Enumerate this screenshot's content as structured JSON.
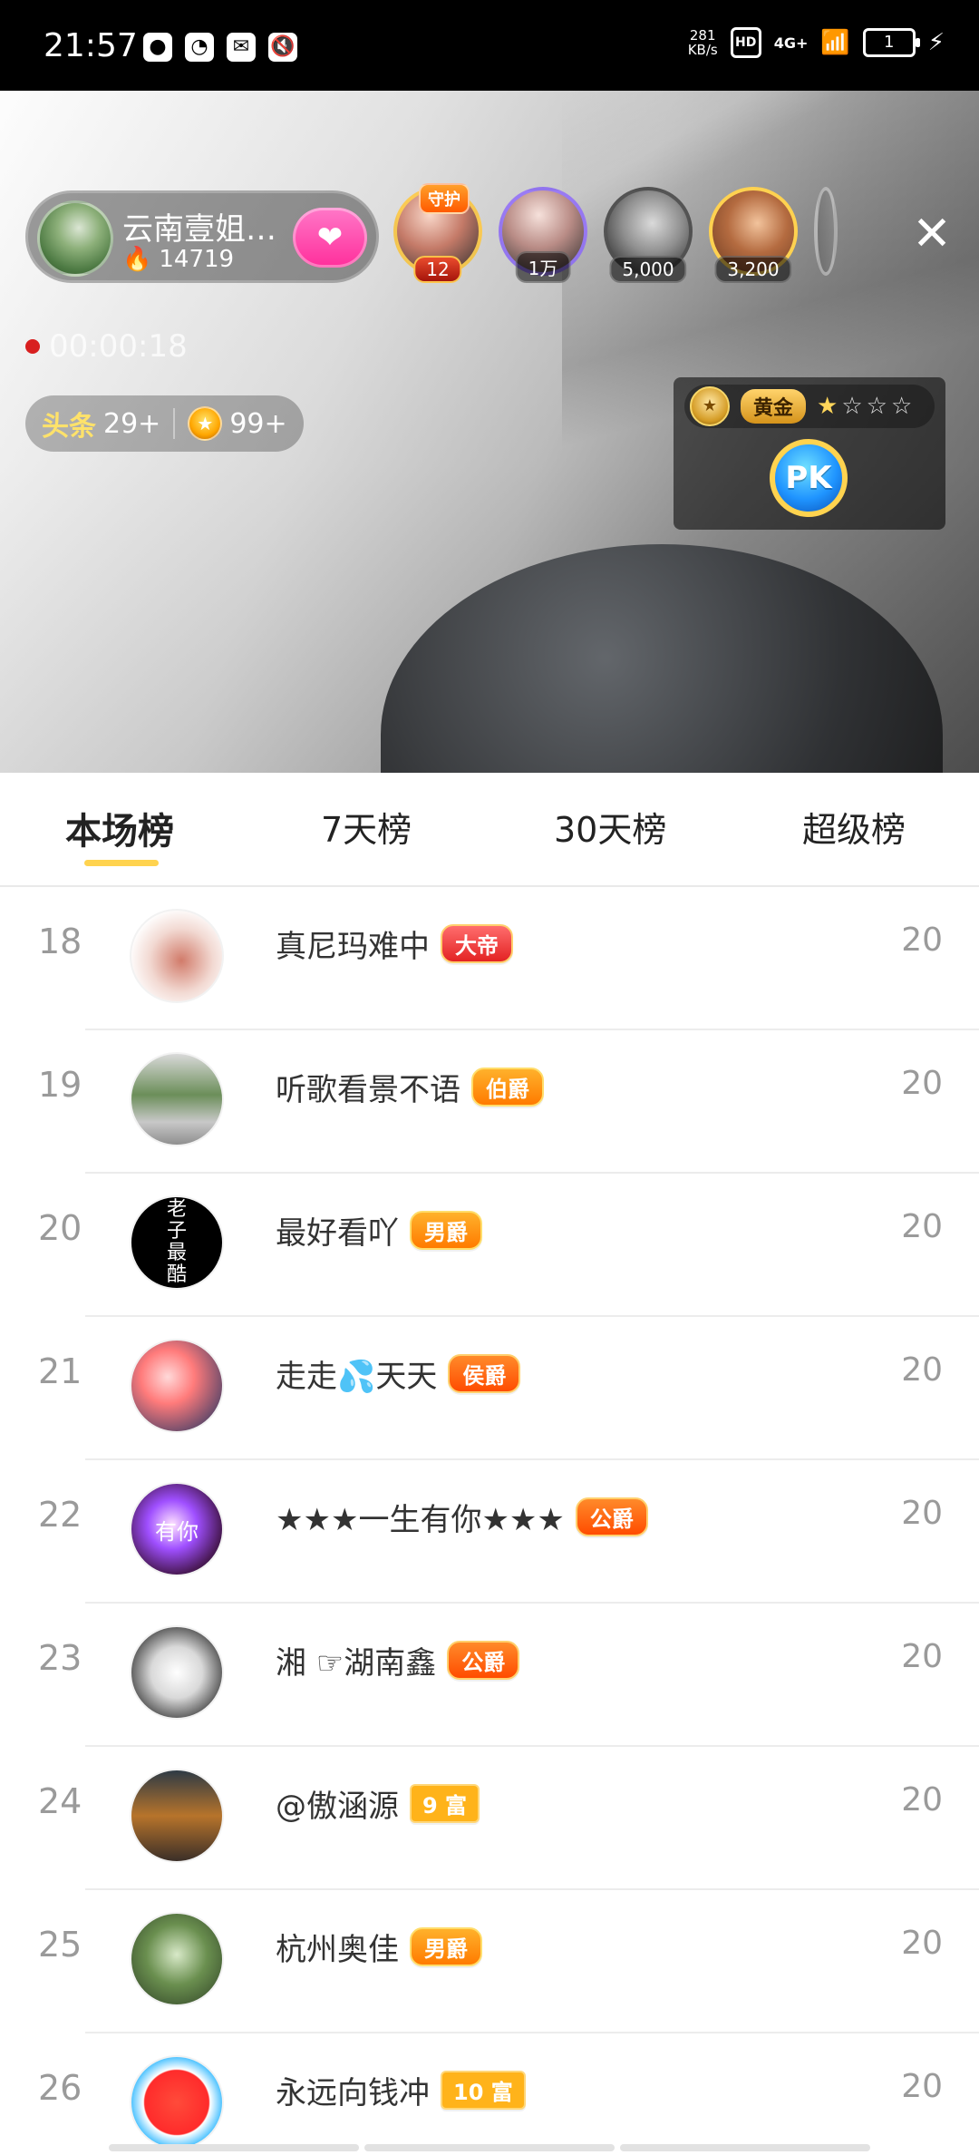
{
  "status_bar": {
    "time": "21:57",
    "net_speed_top": "281",
    "net_speed_bottom": "KB/s",
    "hd": "HD",
    "signal": "4G+",
    "battery": "1"
  },
  "live": {
    "host": {
      "name": "云南壹姐…",
      "heat": "14719"
    },
    "audience": [
      {
        "top_badge": "守护",
        "label": "12"
      },
      {
        "label": "1万"
      },
      {
        "label": "5,000"
      },
      {
        "label": "3,200"
      }
    ],
    "record_time": "00:00:18",
    "chips": [
      {
        "icon_text": "头条",
        "value": "29+"
      },
      {
        "value": "99+"
      }
    ],
    "pk": {
      "rank_name": "黄金",
      "stars_on": 1,
      "stars_total": 4,
      "button_label": "PK"
    }
  },
  "tabs": [
    {
      "label": "本场榜",
      "active": true
    },
    {
      "label": "7天榜"
    },
    {
      "label": "30天榜"
    },
    {
      "label": "超级榜"
    }
  ],
  "ranking": [
    {
      "rank": "18",
      "name": "真尼玛难中",
      "tag": "大帝",
      "tag_style": "red",
      "score": "20"
    },
    {
      "rank": "19",
      "name": "听歌看景不语",
      "tag": "伯爵",
      "tag_style": "gold",
      "score": "20"
    },
    {
      "rank": "20",
      "name": "最好看吖",
      "tag": "男爵",
      "tag_style": "gold",
      "score": "20"
    },
    {
      "rank": "21",
      "name": "走走💦天天",
      "tag": "侯爵",
      "tag_style": "orange",
      "score": "20"
    },
    {
      "rank": "22",
      "name": "★★★一生有你★★★",
      "tag": "公爵",
      "tag_style": "orange",
      "score": "20"
    },
    {
      "rank": "23",
      "name": "湘  ☞湖南鑫",
      "tag": "公爵",
      "tag_style": "orange",
      "score": "20"
    },
    {
      "rank": "24",
      "name": "@傲涵源",
      "tag": "9 富",
      "tag_style": "rich",
      "score": "20"
    },
    {
      "rank": "25",
      "name": "杭州奥佳",
      "tag": "男爵",
      "tag_style": "gold",
      "score": "20"
    },
    {
      "rank": "26",
      "name": "永远向钱冲",
      "tag": "10 富",
      "tag_style": "rich",
      "score": "20"
    }
  ],
  "avatar_texts": {
    "row20": "老\n子\n最\n酷",
    "row22": "有你"
  }
}
